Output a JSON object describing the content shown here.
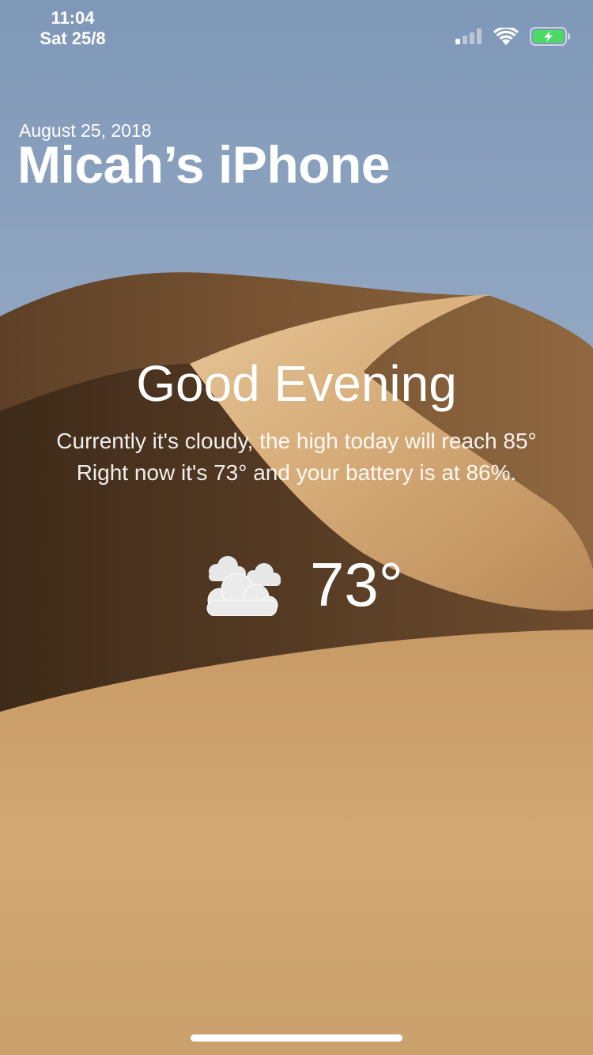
{
  "status_bar": {
    "time": "11:04",
    "date": "Sat 25/8",
    "icons": [
      "cellular-signal-icon",
      "wifi-icon",
      "battery-charging-icon"
    ]
  },
  "header": {
    "date": "August 25, 2018",
    "device_name": "Micah’s iPhone"
  },
  "greeting": {
    "title": "Good Evening",
    "line1": "Currently it's cloudy, the high today will reach 85°",
    "line2": "Right now it's 73° and your battery is at 86%."
  },
  "weather": {
    "icon": "cloudy-icon",
    "temperature": "73°"
  },
  "colors": {
    "sky_top": "#7f98b8",
    "sky_bottom": "#b6c3d6",
    "sand_light": "#d2a56d",
    "sand_dark": "#6b4b2e",
    "battery_green": "#4cd964"
  }
}
